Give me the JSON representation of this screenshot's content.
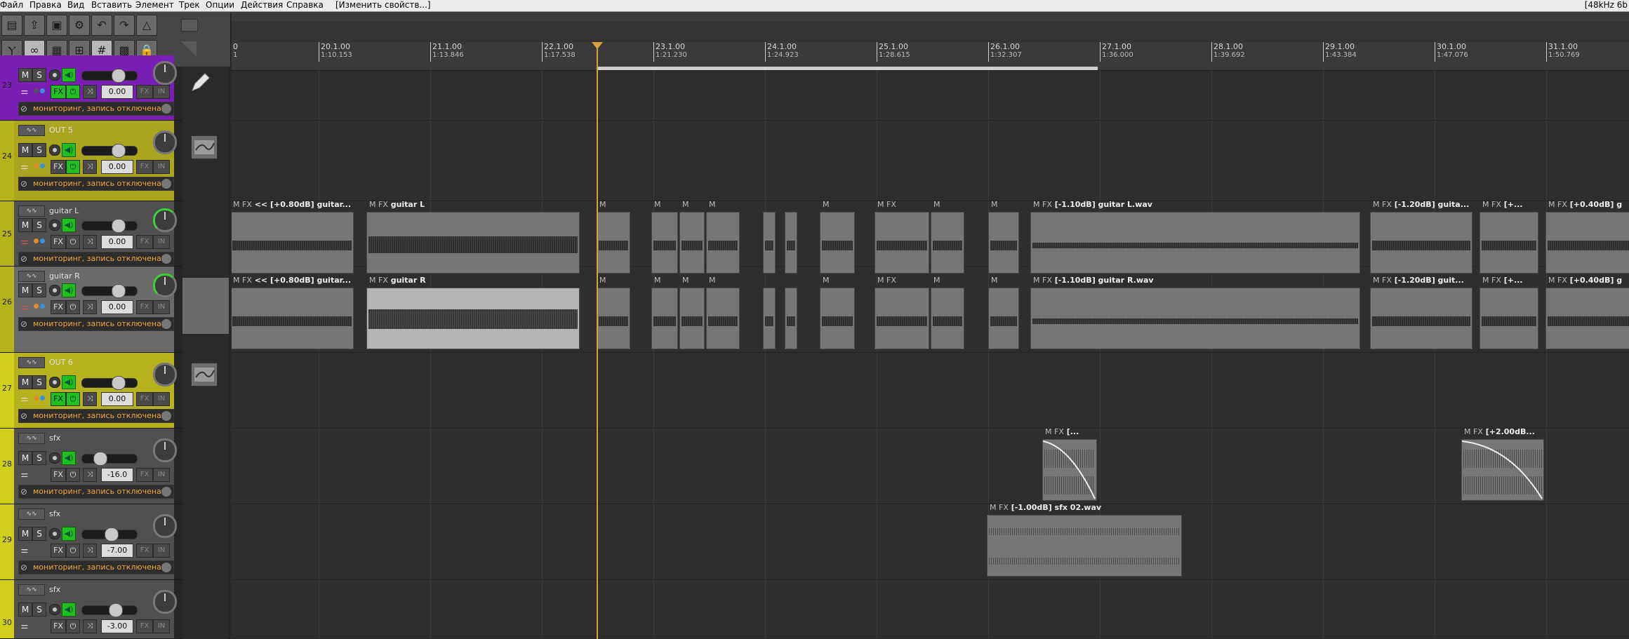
{
  "menu": {
    "items": [
      "Файл",
      "Правка",
      "Вид",
      "Вставить",
      "Элемент",
      "Трек",
      "Опции",
      "Действия",
      "Справка"
    ],
    "info": "[Изменить свойств...]",
    "right": "[48kHz 6b"
  },
  "ruler": {
    "start_label": "0",
    "start_sub": "1",
    "bars": [
      {
        "label": "20.1.00",
        "sub": "1:10.153"
      },
      {
        "label": "21.1.00",
        "sub": "1:13.846"
      },
      {
        "label": "22.1.00",
        "sub": "1:17.538"
      },
      {
        "label": "23.1.00",
        "sub": "1:21.230"
      },
      {
        "label": "24.1.00",
        "sub": "1:24.923"
      },
      {
        "label": "25.1.00",
        "sub": "1:28.615"
      },
      {
        "label": "26.1.00",
        "sub": "1:32.307"
      },
      {
        "label": "27.1.00",
        "sub": "1:36.000"
      },
      {
        "label": "28.1.00",
        "sub": "1:39.692"
      },
      {
        "label": "29.1.00",
        "sub": "1:43.384"
      },
      {
        "label": "30.1.00",
        "sub": "1:47.076"
      },
      {
        "label": "31.1.00",
        "sub": "1:50.769"
      }
    ]
  },
  "tracks": [
    {
      "num": "23",
      "name": "",
      "color": "#7a1fb5",
      "volume": "0.00",
      "monitor": "мониторинг, запись отключена",
      "fx_on": true
    },
    {
      "num": "24",
      "name": "OUT 5",
      "color": "#b6b21a",
      "volume": "0.00",
      "monitor": "мониторинг, запись отключена",
      "fx_on": false
    },
    {
      "num": "25",
      "name": "guitar L",
      "color": "#b6b21a",
      "volume": "0.00",
      "monitor": "мониторинг, запись отключена",
      "fx_on": false
    },
    {
      "num": "26",
      "name": "guitar R",
      "color": "#b6b21a",
      "volume": "0.00",
      "monitor": "мониторинг, запись отключена",
      "fx_on": false
    },
    {
      "num": "27",
      "name": "OUT 6",
      "color": "#d2cf1a",
      "volume": "0.00",
      "monitor": "мониторинг, запись отключена",
      "fx_on": true
    },
    {
      "num": "28",
      "name": "sfx",
      "color": "#d2cf1a",
      "volume": "-16.0",
      "monitor": "мониторинг, запись отключена",
      "fx_on": false
    },
    {
      "num": "29",
      "name": "sfx",
      "color": "#d2cf1a",
      "volume": "-7.00",
      "monitor": "мониторинг, запись отключена",
      "fx_on": false
    },
    {
      "num": "30",
      "name": "sfx",
      "color": "#d2cf1a",
      "volume": "-3.00",
      "monitor": "",
      "fx_on": false
    }
  ],
  "track_controls": {
    "m": "M",
    "s": "S",
    "fx": "FX",
    "fx2": "FX",
    "in": "IN"
  },
  "items": {
    "guitarL": [
      {
        "mfx": "M FX",
        "name": "<< [+0.80dB] guitar..."
      },
      {
        "mfx": "M FX",
        "name": "guitar L"
      },
      {
        "mfx": "M",
        "name": ""
      },
      {
        "mfx": "M",
        "name": ""
      },
      {
        "mfx": "M",
        "name": ""
      },
      {
        "mfx": "M",
        "name": ""
      },
      {
        "mfx": "M",
        "name": ""
      },
      {
        "mfx": "M FX",
        "name": ""
      },
      {
        "mfx": "M",
        "name": ""
      },
      {
        "mfx": "M",
        "name": ""
      },
      {
        "mfx": "M FX",
        "name": "[-1.10dB] guitar L.wav"
      },
      {
        "mfx": "M FX",
        "name": "[-1.20dB] guita..."
      },
      {
        "mfx": "M FX",
        "name": "[+..."
      },
      {
        "mfx": "M FX",
        "name": "[+0.40dB] g"
      }
    ],
    "guitarR": [
      {
        "mfx": "M FX",
        "name": "<< [+0.80dB] guitar..."
      },
      {
        "mfx": "M FX",
        "name": "guitar R"
      },
      {
        "mfx": "M",
        "name": ""
      },
      {
        "mfx": "M",
        "name": ""
      },
      {
        "mfx": "M",
        "name": ""
      },
      {
        "mfx": "M",
        "name": ""
      },
      {
        "mfx": "M",
        "name": ""
      },
      {
        "mfx": "M FX",
        "name": ""
      },
      {
        "mfx": "M",
        "name": ""
      },
      {
        "mfx": "M",
        "name": ""
      },
      {
        "mfx": "M FX",
        "name": "[-1.10dB] guitar R.wav"
      },
      {
        "mfx": "M FX",
        "name": "[-1.20dB] guit..."
      },
      {
        "mfx": "M FX",
        "name": "[+..."
      },
      {
        "mfx": "M FX",
        "name": "[+0.40dB] g"
      }
    ],
    "sfx28": [
      {
        "mfx": "M FX",
        "name": "[..."
      },
      {
        "mfx": "M FX",
        "name": "[+2.00dB..."
      }
    ],
    "sfx29": [
      {
        "mfx": "M FX",
        "name": "[-1.00dB] sfx 02.wav"
      }
    ]
  }
}
